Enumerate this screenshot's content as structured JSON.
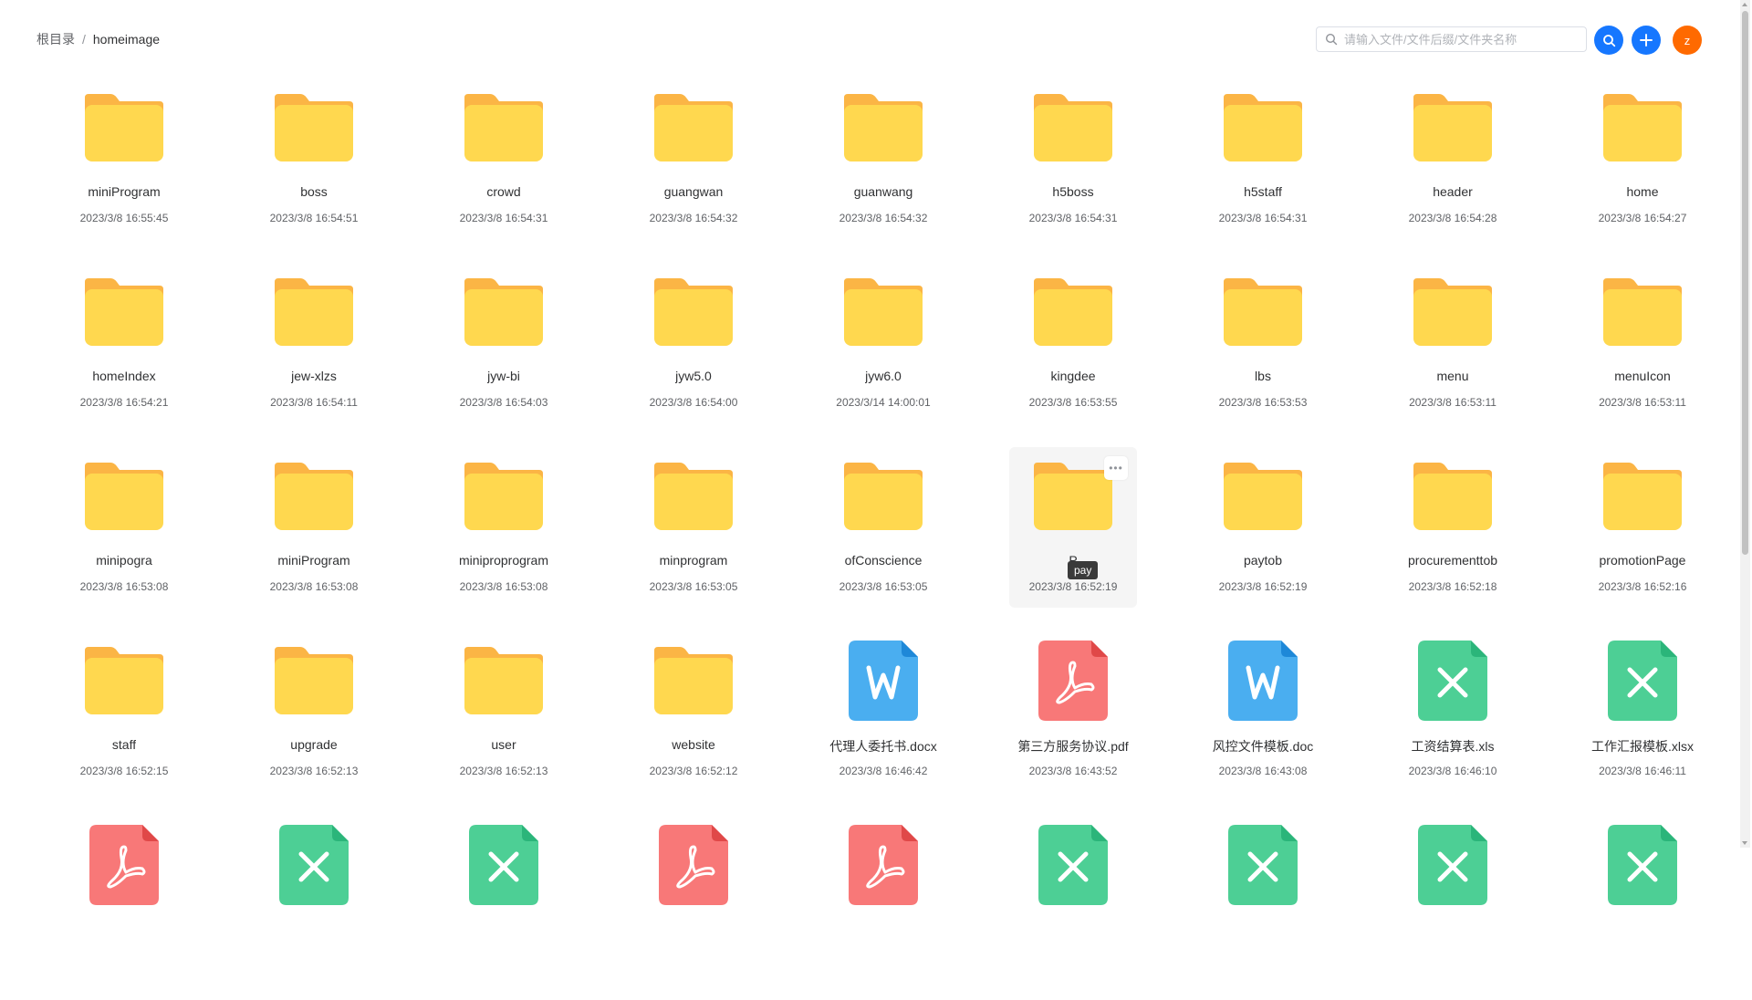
{
  "breadcrumb": {
    "root": "根目录",
    "separator": "/",
    "current": "homeimage"
  },
  "search": {
    "placeholder": "请输入文件/文件后缀/文件夹名称",
    "value": ""
  },
  "header": {
    "search_button": "search",
    "add_button": "+",
    "avatar_letter": "z"
  },
  "colors": {
    "primary": "#1677ff",
    "avatar": "#ff6a00",
    "folder": "#ffd84f",
    "folder_tab": "#fbb545",
    "word": "#4aaef0",
    "pdf": "#f87878",
    "excel": "#4dcf95"
  },
  "tooltip": "pay",
  "hovered_index": 23,
  "items": [
    {
      "name": "miniProgram",
      "date": "2023/3/8 16:55:45",
      "type": "folder"
    },
    {
      "name": "boss",
      "date": "2023/3/8 16:54:51",
      "type": "folder"
    },
    {
      "name": "crowd",
      "date": "2023/3/8 16:54:31",
      "type": "folder"
    },
    {
      "name": "guangwan",
      "date": "2023/3/8 16:54:32",
      "type": "folder"
    },
    {
      "name": "guanwang",
      "date": "2023/3/8 16:54:32",
      "type": "folder"
    },
    {
      "name": "h5boss",
      "date": "2023/3/8 16:54:31",
      "type": "folder"
    },
    {
      "name": "h5staff",
      "date": "2023/3/8 16:54:31",
      "type": "folder"
    },
    {
      "name": "header",
      "date": "2023/3/8 16:54:28",
      "type": "folder"
    },
    {
      "name": "home",
      "date": "2023/3/8 16:54:27",
      "type": "folder"
    },
    {
      "name": "homeIndex",
      "date": "2023/3/8 16:54:21",
      "type": "folder"
    },
    {
      "name": "jew-xlzs",
      "date": "2023/3/8 16:54:11",
      "type": "folder"
    },
    {
      "name": "jyw-bi",
      "date": "2023/3/8 16:54:03",
      "type": "folder"
    },
    {
      "name": "jyw5.0",
      "date": "2023/3/8 16:54:00",
      "type": "folder"
    },
    {
      "name": "jyw6.0",
      "date": "2023/3/14 14:00:01",
      "type": "folder"
    },
    {
      "name": "kingdee",
      "date": "2023/3/8 16:53:55",
      "type": "folder"
    },
    {
      "name": "lbs",
      "date": "2023/3/8 16:53:53",
      "type": "folder"
    },
    {
      "name": "menu",
      "date": "2023/3/8 16:53:11",
      "type": "folder"
    },
    {
      "name": "menuIcon",
      "date": "2023/3/8 16:53:11",
      "type": "folder"
    },
    {
      "name": "minipogra",
      "date": "2023/3/8 16:53:08",
      "type": "folder"
    },
    {
      "name": "miniProgram",
      "date": "2023/3/8 16:53:08",
      "type": "folder"
    },
    {
      "name": "miniproprogram",
      "date": "2023/3/8 16:53:08",
      "type": "folder"
    },
    {
      "name": "minprogram",
      "date": "2023/3/8 16:53:05",
      "type": "folder"
    },
    {
      "name": "ofConscience",
      "date": "2023/3/8 16:53:05",
      "type": "folder"
    },
    {
      "name": "P",
      "date": "2023/3/8 16:52:19",
      "type": "folder"
    },
    {
      "name": "paytob",
      "date": "2023/3/8 16:52:19",
      "type": "folder"
    },
    {
      "name": "procurementtob",
      "date": "2023/3/8 16:52:18",
      "type": "folder"
    },
    {
      "name": "promotionPage",
      "date": "2023/3/8 16:52:16",
      "type": "folder"
    },
    {
      "name": "staff",
      "date": "2023/3/8 16:52:15",
      "type": "folder"
    },
    {
      "name": "upgrade",
      "date": "2023/3/8 16:52:13",
      "type": "folder"
    },
    {
      "name": "user",
      "date": "2023/3/8 16:52:13",
      "type": "folder"
    },
    {
      "name": "website",
      "date": "2023/3/8 16:52:12",
      "type": "folder"
    },
    {
      "name": "代理人委托书.docx",
      "date": "2023/3/8 16:46:42",
      "type": "word"
    },
    {
      "name": "第三方服务协议.pdf",
      "date": "2023/3/8 16:43:52",
      "type": "pdf"
    },
    {
      "name": "风控文件模板.doc",
      "date": "2023/3/8 16:43:08",
      "type": "word"
    },
    {
      "name": "工资结算表.xls",
      "date": "2023/3/8 16:46:10",
      "type": "excel"
    },
    {
      "name": "工作汇报模板.xlsx",
      "date": "2023/3/8 16:46:11",
      "type": "excel"
    },
    {
      "name": "",
      "date": "",
      "type": "pdf"
    },
    {
      "name": "",
      "date": "",
      "type": "excel"
    },
    {
      "name": "",
      "date": "",
      "type": "excel"
    },
    {
      "name": "",
      "date": "",
      "type": "pdf"
    },
    {
      "name": "",
      "date": "",
      "type": "pdf"
    },
    {
      "name": "",
      "date": "",
      "type": "excel"
    },
    {
      "name": "",
      "date": "",
      "type": "excel"
    },
    {
      "name": "",
      "date": "",
      "type": "excel"
    },
    {
      "name": "",
      "date": "",
      "type": "excel"
    }
  ]
}
